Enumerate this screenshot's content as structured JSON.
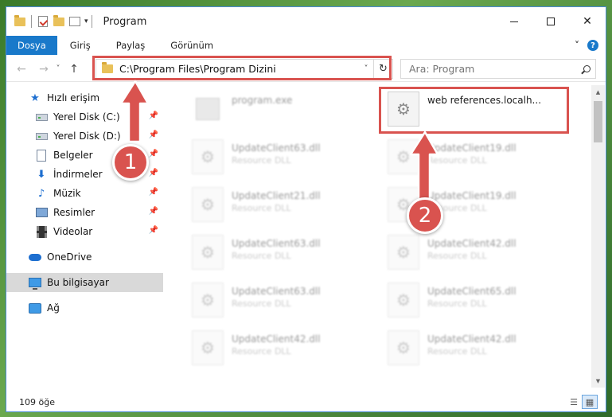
{
  "window": {
    "title": "Program"
  },
  "ribbon": {
    "tabs": [
      {
        "label": "Dosya"
      },
      {
        "label": "Giriş"
      },
      {
        "label": "Paylaş"
      },
      {
        "label": "Görünüm"
      }
    ]
  },
  "address": {
    "path": "C:\\Program Files\\Program Dizini"
  },
  "search": {
    "placeholder": "Ara: Program"
  },
  "sidebar": {
    "items": [
      {
        "label": "Hızlı erişim",
        "icon": "star-icon"
      },
      {
        "label": "Yerel Disk (C:)",
        "icon": "drive-icon",
        "pinned": true
      },
      {
        "label": "Yerel Disk (D:)",
        "icon": "drive-icon",
        "pinned": true
      },
      {
        "label": "Belgeler",
        "icon": "documents-icon",
        "pinned": true
      },
      {
        "label": "İndirmeler",
        "icon": "download-icon",
        "pinned": true
      },
      {
        "label": "Müzik",
        "icon": "music-icon",
        "pinned": true
      },
      {
        "label": "Resimler",
        "icon": "pictures-icon",
        "pinned": true
      },
      {
        "label": "Videolar",
        "icon": "videos-icon",
        "pinned": true
      },
      {
        "label": "OneDrive",
        "icon": "cloud-icon"
      },
      {
        "label": "Bu bilgisayar",
        "icon": "computer-icon",
        "selected": true
      },
      {
        "label": "Ağ",
        "icon": "network-icon"
      }
    ]
  },
  "files": {
    "left": [
      {
        "name": "program.exe",
        "desc": ""
      },
      {
        "name": "UpdateClient63.dll",
        "desc": "Resource DLL"
      },
      {
        "name": "UpdateClient21.dll",
        "desc": "Resource DLL"
      },
      {
        "name": "UpdateClient63.dll",
        "desc": "Resource DLL"
      },
      {
        "name": "UpdateClient63.dll",
        "desc": "Resource DLL"
      },
      {
        "name": "UpdateClient42.dll",
        "desc": "Resource DLL"
      }
    ],
    "right": [
      {
        "name": "web references.localh...",
        "desc": ""
      },
      {
        "name": "UpdateClient19.dll",
        "desc": "Resource DLL"
      },
      {
        "name": "UpdateClient19.dll",
        "desc": "Resource DLL"
      },
      {
        "name": "UpdateClient42.dll",
        "desc": "Resource DLL"
      },
      {
        "name": "UpdateClient65.dll",
        "desc": "Resource DLL"
      },
      {
        "name": "UpdateClient42.dll",
        "desc": "Resource DLL"
      }
    ]
  },
  "status": {
    "item_count": "109 öğe"
  },
  "callouts": {
    "one": "1",
    "two": "2"
  },
  "colors": {
    "accent": "#1979ca",
    "highlight": "#d9534f"
  },
  "glyphs": {
    "back": "←",
    "forward": "→",
    "recent": "˅",
    "up": "↑",
    "refresh": "↻",
    "caret": "˅",
    "close": "✕",
    "help": "?",
    "ribbon_expand": "˅",
    "pin": "📌"
  }
}
